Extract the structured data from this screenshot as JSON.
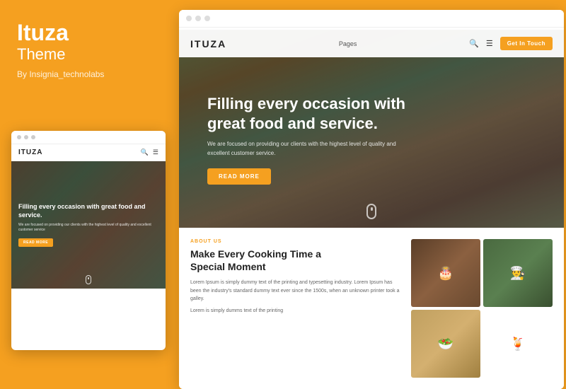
{
  "background_color": "#F5A020",
  "left_panel": {
    "brand": "Ituza",
    "subtitle": "Theme",
    "by_line": "By Insignia_technolabs"
  },
  "mini_browser": {
    "logo": "ITUZA",
    "hero_title": "Filling every occasion with great food and service.",
    "hero_sub": "We are focused on providing our clients with the highest level of quality and excellent customer service",
    "hero_btn": "READ MORE"
  },
  "main_browser": {
    "nav": {
      "logo": "ITUZA",
      "pages_label": "Pages",
      "cta_btn": "Get In Touch"
    },
    "hero": {
      "title": "Filling every occasion with great food and service.",
      "subtitle": "We are focused on providing our clients with the highest level of quality and excellent customer service.",
      "cta_btn": "READ MORE"
    },
    "content": {
      "about_label": "ABOUT US",
      "title_line1": "Make Every Cooking Time a",
      "title_line2": "Special Moment",
      "paragraph1": "Lorem Ipsum is simply dummy text of the printing and typesetting industry. Lorem Ipsum has been the industry's standard dummy text ever since the 1500s, when an unknown printer took a galley.",
      "paragraph2": "Lorem is simply dumms text of the printing"
    }
  }
}
